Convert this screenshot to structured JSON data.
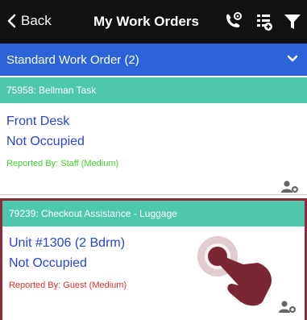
{
  "nav": {
    "back_label": "Back",
    "title": "My Work Orders",
    "icons": [
      "phone-location-icon",
      "list-add-icon",
      "filter-icon"
    ]
  },
  "section": {
    "label": "Standard Work Order (2)",
    "icon": "chevron-down-icon"
  },
  "orders": [
    {
      "header": "75958:  Bellman Task",
      "location": "Front Desk",
      "status": "Not Occupied",
      "reported": "Reported By: Staff  (Medium)",
      "reported_color": "#3ecf2a",
      "icon": "assign-user-icon"
    },
    {
      "header": "79239:  Checkout Assistance - Luggage",
      "location": "Unit #1306 (2 Bdrm)",
      "status": "Not Occupied",
      "reported": "Reported By: Guest  (Medium)",
      "reported_color": "#e0312f",
      "icon": "assign-user-icon"
    }
  ],
  "colors": {
    "nav_bg": "#111111",
    "section_bg": "#2c63d8",
    "card_header_bg": "#4fc7ad",
    "link_text": "#2844d8",
    "selected_border": "#8e2b3b"
  }
}
